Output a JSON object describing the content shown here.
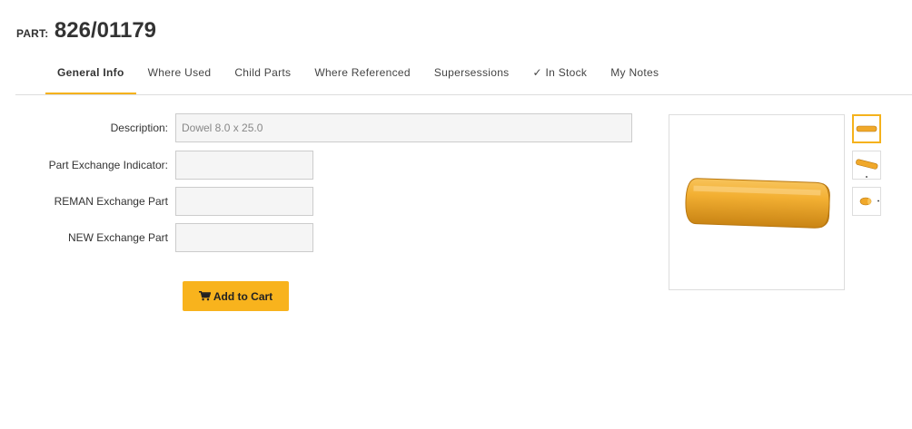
{
  "header": {
    "prefix": "PART:",
    "part_number": "826/01179"
  },
  "tabs": [
    {
      "label": "General Info",
      "active": true
    },
    {
      "label": "Where Used"
    },
    {
      "label": "Child Parts"
    },
    {
      "label": "Where Referenced"
    },
    {
      "label": "Supersessions"
    },
    {
      "label": "In Stock",
      "icon": "check-icon"
    },
    {
      "label": "My Notes"
    }
  ],
  "form": {
    "description": {
      "label": "Description:",
      "value": "Dowel 8.0 x 25.0"
    },
    "part_exchange_indicator": {
      "label": "Part Exchange Indicator:",
      "value": ""
    },
    "reman_exchange_part": {
      "label": "REMAN Exchange Part",
      "value": ""
    },
    "new_exchange_part": {
      "label": "NEW Exchange Part",
      "value": ""
    }
  },
  "cart": {
    "label": "Add to Cart",
    "icon": "cart-icon"
  },
  "gallery": {
    "main": "dowel-side-view",
    "thumbnails": [
      "dowel-side-view",
      "dowel-angled-view",
      "dowel-end-view"
    ]
  },
  "colors": {
    "accent": "#f5b21c",
    "part_gold": "#f0a82a"
  }
}
